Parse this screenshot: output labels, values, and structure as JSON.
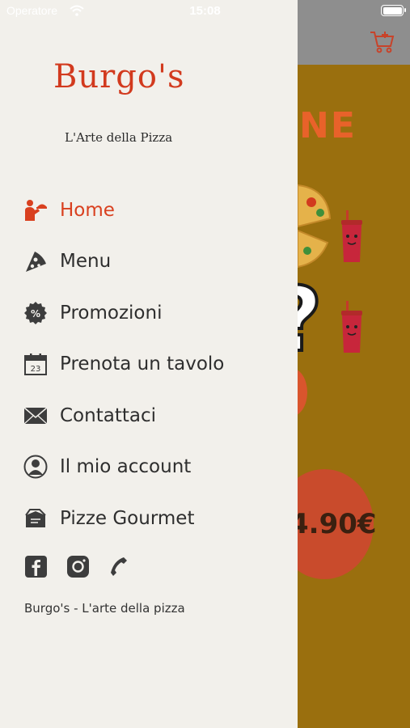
{
  "status_bar": {
    "carrier": "Operatore",
    "time": "15:08"
  },
  "brand": {
    "logo_text": "Burgo's",
    "tagline": "L'Arte della Pizza"
  },
  "drawer": {
    "items": [
      {
        "label": "Home",
        "icon": "waiter-icon",
        "active": true
      },
      {
        "label": "Menu",
        "icon": "pizza-slice-icon",
        "active": false
      },
      {
        "label": "Promozioni",
        "icon": "percent-badge-icon",
        "active": false
      },
      {
        "label": "Prenota un tavolo",
        "icon": "calendar-icon",
        "active": false
      },
      {
        "label": "Contattaci",
        "icon": "envelope-icon",
        "active": false
      },
      {
        "label": "Il mio account",
        "icon": "user-circle-icon",
        "active": false
      },
      {
        "label": "Pizze Gourmet",
        "icon": "pizza-box-icon",
        "active": false
      }
    ],
    "socials": [
      "facebook-icon",
      "instagram-icon",
      "phone-icon"
    ],
    "footer": "Burgo's - L'arte della pizza"
  },
  "background": {
    "promo_word_fragment": "NE",
    "price_fragment": "4.90€"
  },
  "colors": {
    "accent": "#d9401f",
    "drawer_bg": "#f2f0eb",
    "header_bg": "#8e8e8e",
    "page_bg": "#9a6f0e"
  }
}
